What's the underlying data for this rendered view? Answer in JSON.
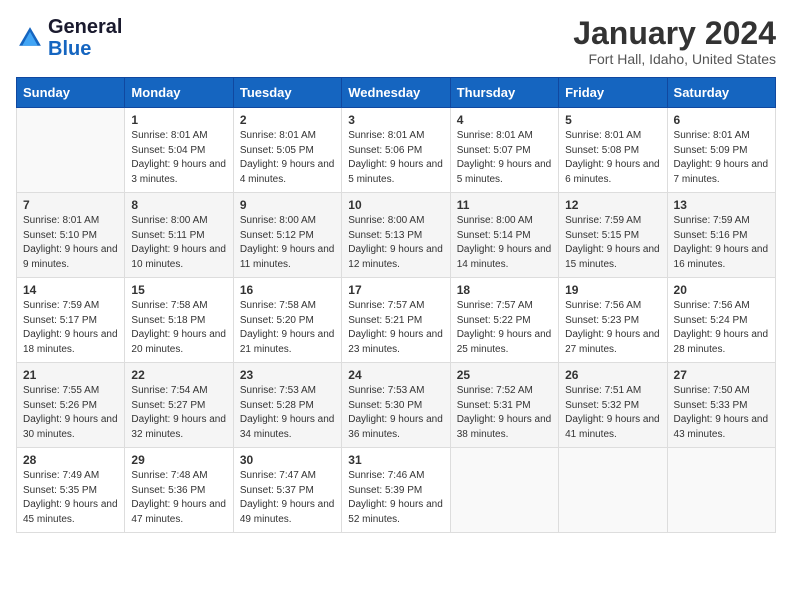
{
  "logo": {
    "text_general": "General",
    "text_blue": "Blue"
  },
  "header": {
    "title": "January 2024",
    "subtitle": "Fort Hall, Idaho, United States"
  },
  "weekdays": [
    "Sunday",
    "Monday",
    "Tuesday",
    "Wednesday",
    "Thursday",
    "Friday",
    "Saturday"
  ],
  "weeks": [
    [
      {
        "day": "",
        "sunrise": "",
        "sunset": "",
        "daylight": ""
      },
      {
        "day": "1",
        "sunrise": "Sunrise: 8:01 AM",
        "sunset": "Sunset: 5:04 PM",
        "daylight": "Daylight: 9 hours and 3 minutes."
      },
      {
        "day": "2",
        "sunrise": "Sunrise: 8:01 AM",
        "sunset": "Sunset: 5:05 PM",
        "daylight": "Daylight: 9 hours and 4 minutes."
      },
      {
        "day": "3",
        "sunrise": "Sunrise: 8:01 AM",
        "sunset": "Sunset: 5:06 PM",
        "daylight": "Daylight: 9 hours and 5 minutes."
      },
      {
        "day": "4",
        "sunrise": "Sunrise: 8:01 AM",
        "sunset": "Sunset: 5:07 PM",
        "daylight": "Daylight: 9 hours and 5 minutes."
      },
      {
        "day": "5",
        "sunrise": "Sunrise: 8:01 AM",
        "sunset": "Sunset: 5:08 PM",
        "daylight": "Daylight: 9 hours and 6 minutes."
      },
      {
        "day": "6",
        "sunrise": "Sunrise: 8:01 AM",
        "sunset": "Sunset: 5:09 PM",
        "daylight": "Daylight: 9 hours and 7 minutes."
      }
    ],
    [
      {
        "day": "7",
        "sunrise": "Sunrise: 8:01 AM",
        "sunset": "Sunset: 5:10 PM",
        "daylight": "Daylight: 9 hours and 9 minutes."
      },
      {
        "day": "8",
        "sunrise": "Sunrise: 8:00 AM",
        "sunset": "Sunset: 5:11 PM",
        "daylight": "Daylight: 9 hours and 10 minutes."
      },
      {
        "day": "9",
        "sunrise": "Sunrise: 8:00 AM",
        "sunset": "Sunset: 5:12 PM",
        "daylight": "Daylight: 9 hours and 11 minutes."
      },
      {
        "day": "10",
        "sunrise": "Sunrise: 8:00 AM",
        "sunset": "Sunset: 5:13 PM",
        "daylight": "Daylight: 9 hours and 12 minutes."
      },
      {
        "day": "11",
        "sunrise": "Sunrise: 8:00 AM",
        "sunset": "Sunset: 5:14 PM",
        "daylight": "Daylight: 9 hours and 14 minutes."
      },
      {
        "day": "12",
        "sunrise": "Sunrise: 7:59 AM",
        "sunset": "Sunset: 5:15 PM",
        "daylight": "Daylight: 9 hours and 15 minutes."
      },
      {
        "day": "13",
        "sunrise": "Sunrise: 7:59 AM",
        "sunset": "Sunset: 5:16 PM",
        "daylight": "Daylight: 9 hours and 16 minutes."
      }
    ],
    [
      {
        "day": "14",
        "sunrise": "Sunrise: 7:59 AM",
        "sunset": "Sunset: 5:17 PM",
        "daylight": "Daylight: 9 hours and 18 minutes."
      },
      {
        "day": "15",
        "sunrise": "Sunrise: 7:58 AM",
        "sunset": "Sunset: 5:18 PM",
        "daylight": "Daylight: 9 hours and 20 minutes."
      },
      {
        "day": "16",
        "sunrise": "Sunrise: 7:58 AM",
        "sunset": "Sunset: 5:20 PM",
        "daylight": "Daylight: 9 hours and 21 minutes."
      },
      {
        "day": "17",
        "sunrise": "Sunrise: 7:57 AM",
        "sunset": "Sunset: 5:21 PM",
        "daylight": "Daylight: 9 hours and 23 minutes."
      },
      {
        "day": "18",
        "sunrise": "Sunrise: 7:57 AM",
        "sunset": "Sunset: 5:22 PM",
        "daylight": "Daylight: 9 hours and 25 minutes."
      },
      {
        "day": "19",
        "sunrise": "Sunrise: 7:56 AM",
        "sunset": "Sunset: 5:23 PM",
        "daylight": "Daylight: 9 hours and 27 minutes."
      },
      {
        "day": "20",
        "sunrise": "Sunrise: 7:56 AM",
        "sunset": "Sunset: 5:24 PM",
        "daylight": "Daylight: 9 hours and 28 minutes."
      }
    ],
    [
      {
        "day": "21",
        "sunrise": "Sunrise: 7:55 AM",
        "sunset": "Sunset: 5:26 PM",
        "daylight": "Daylight: 9 hours and 30 minutes."
      },
      {
        "day": "22",
        "sunrise": "Sunrise: 7:54 AM",
        "sunset": "Sunset: 5:27 PM",
        "daylight": "Daylight: 9 hours and 32 minutes."
      },
      {
        "day": "23",
        "sunrise": "Sunrise: 7:53 AM",
        "sunset": "Sunset: 5:28 PM",
        "daylight": "Daylight: 9 hours and 34 minutes."
      },
      {
        "day": "24",
        "sunrise": "Sunrise: 7:53 AM",
        "sunset": "Sunset: 5:30 PM",
        "daylight": "Daylight: 9 hours and 36 minutes."
      },
      {
        "day": "25",
        "sunrise": "Sunrise: 7:52 AM",
        "sunset": "Sunset: 5:31 PM",
        "daylight": "Daylight: 9 hours and 38 minutes."
      },
      {
        "day": "26",
        "sunrise": "Sunrise: 7:51 AM",
        "sunset": "Sunset: 5:32 PM",
        "daylight": "Daylight: 9 hours and 41 minutes."
      },
      {
        "day": "27",
        "sunrise": "Sunrise: 7:50 AM",
        "sunset": "Sunset: 5:33 PM",
        "daylight": "Daylight: 9 hours and 43 minutes."
      }
    ],
    [
      {
        "day": "28",
        "sunrise": "Sunrise: 7:49 AM",
        "sunset": "Sunset: 5:35 PM",
        "daylight": "Daylight: 9 hours and 45 minutes."
      },
      {
        "day": "29",
        "sunrise": "Sunrise: 7:48 AM",
        "sunset": "Sunset: 5:36 PM",
        "daylight": "Daylight: 9 hours and 47 minutes."
      },
      {
        "day": "30",
        "sunrise": "Sunrise: 7:47 AM",
        "sunset": "Sunset: 5:37 PM",
        "daylight": "Daylight: 9 hours and 49 minutes."
      },
      {
        "day": "31",
        "sunrise": "Sunrise: 7:46 AM",
        "sunset": "Sunset: 5:39 PM",
        "daylight": "Daylight: 9 hours and 52 minutes."
      },
      {
        "day": "",
        "sunrise": "",
        "sunset": "",
        "daylight": ""
      },
      {
        "day": "",
        "sunrise": "",
        "sunset": "",
        "daylight": ""
      },
      {
        "day": "",
        "sunrise": "",
        "sunset": "",
        "daylight": ""
      }
    ]
  ]
}
